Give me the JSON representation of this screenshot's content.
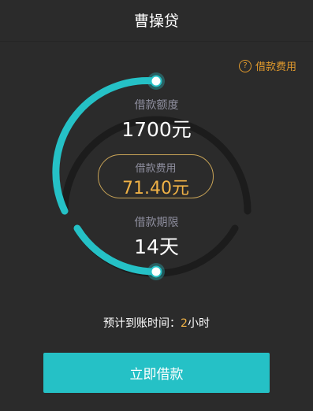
{
  "header": {
    "title": "曹操贷"
  },
  "fee_link": {
    "icon": "question-icon",
    "label": "借款费用"
  },
  "amount": {
    "label": "借款额度",
    "value": "1700元",
    "fraction": 0.3
  },
  "fee": {
    "label": "借款费用",
    "value": "71.40元"
  },
  "term": {
    "label": "借款期限",
    "value": "14天",
    "fraction": 0.2
  },
  "arrival": {
    "prefix": "预计到账时间：",
    "highlight": "2",
    "suffix": "小时"
  },
  "submit": {
    "label": "立即借款"
  },
  "colors": {
    "accent": "#25c1c6",
    "track": "#1c1c1c",
    "gold": "#f0b246",
    "background": "#2b2b2b"
  }
}
